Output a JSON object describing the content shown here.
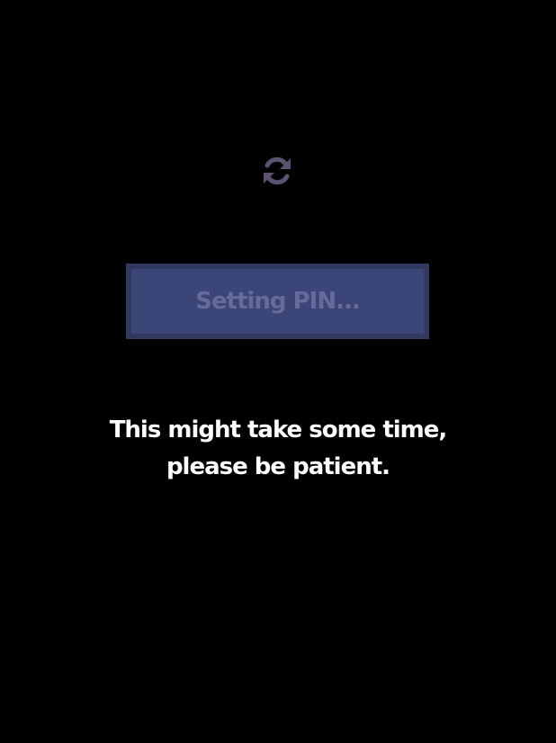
{
  "loading": {
    "icon": "refresh-icon",
    "icon_color": "#5a5270"
  },
  "button": {
    "label": "Setting PIN...",
    "bg_color": "#3c4578",
    "border_color": "#313a5e",
    "text_color": "#666c9a",
    "disabled": true
  },
  "message": {
    "line1": "This might take some time,",
    "line2": "please be patient."
  }
}
